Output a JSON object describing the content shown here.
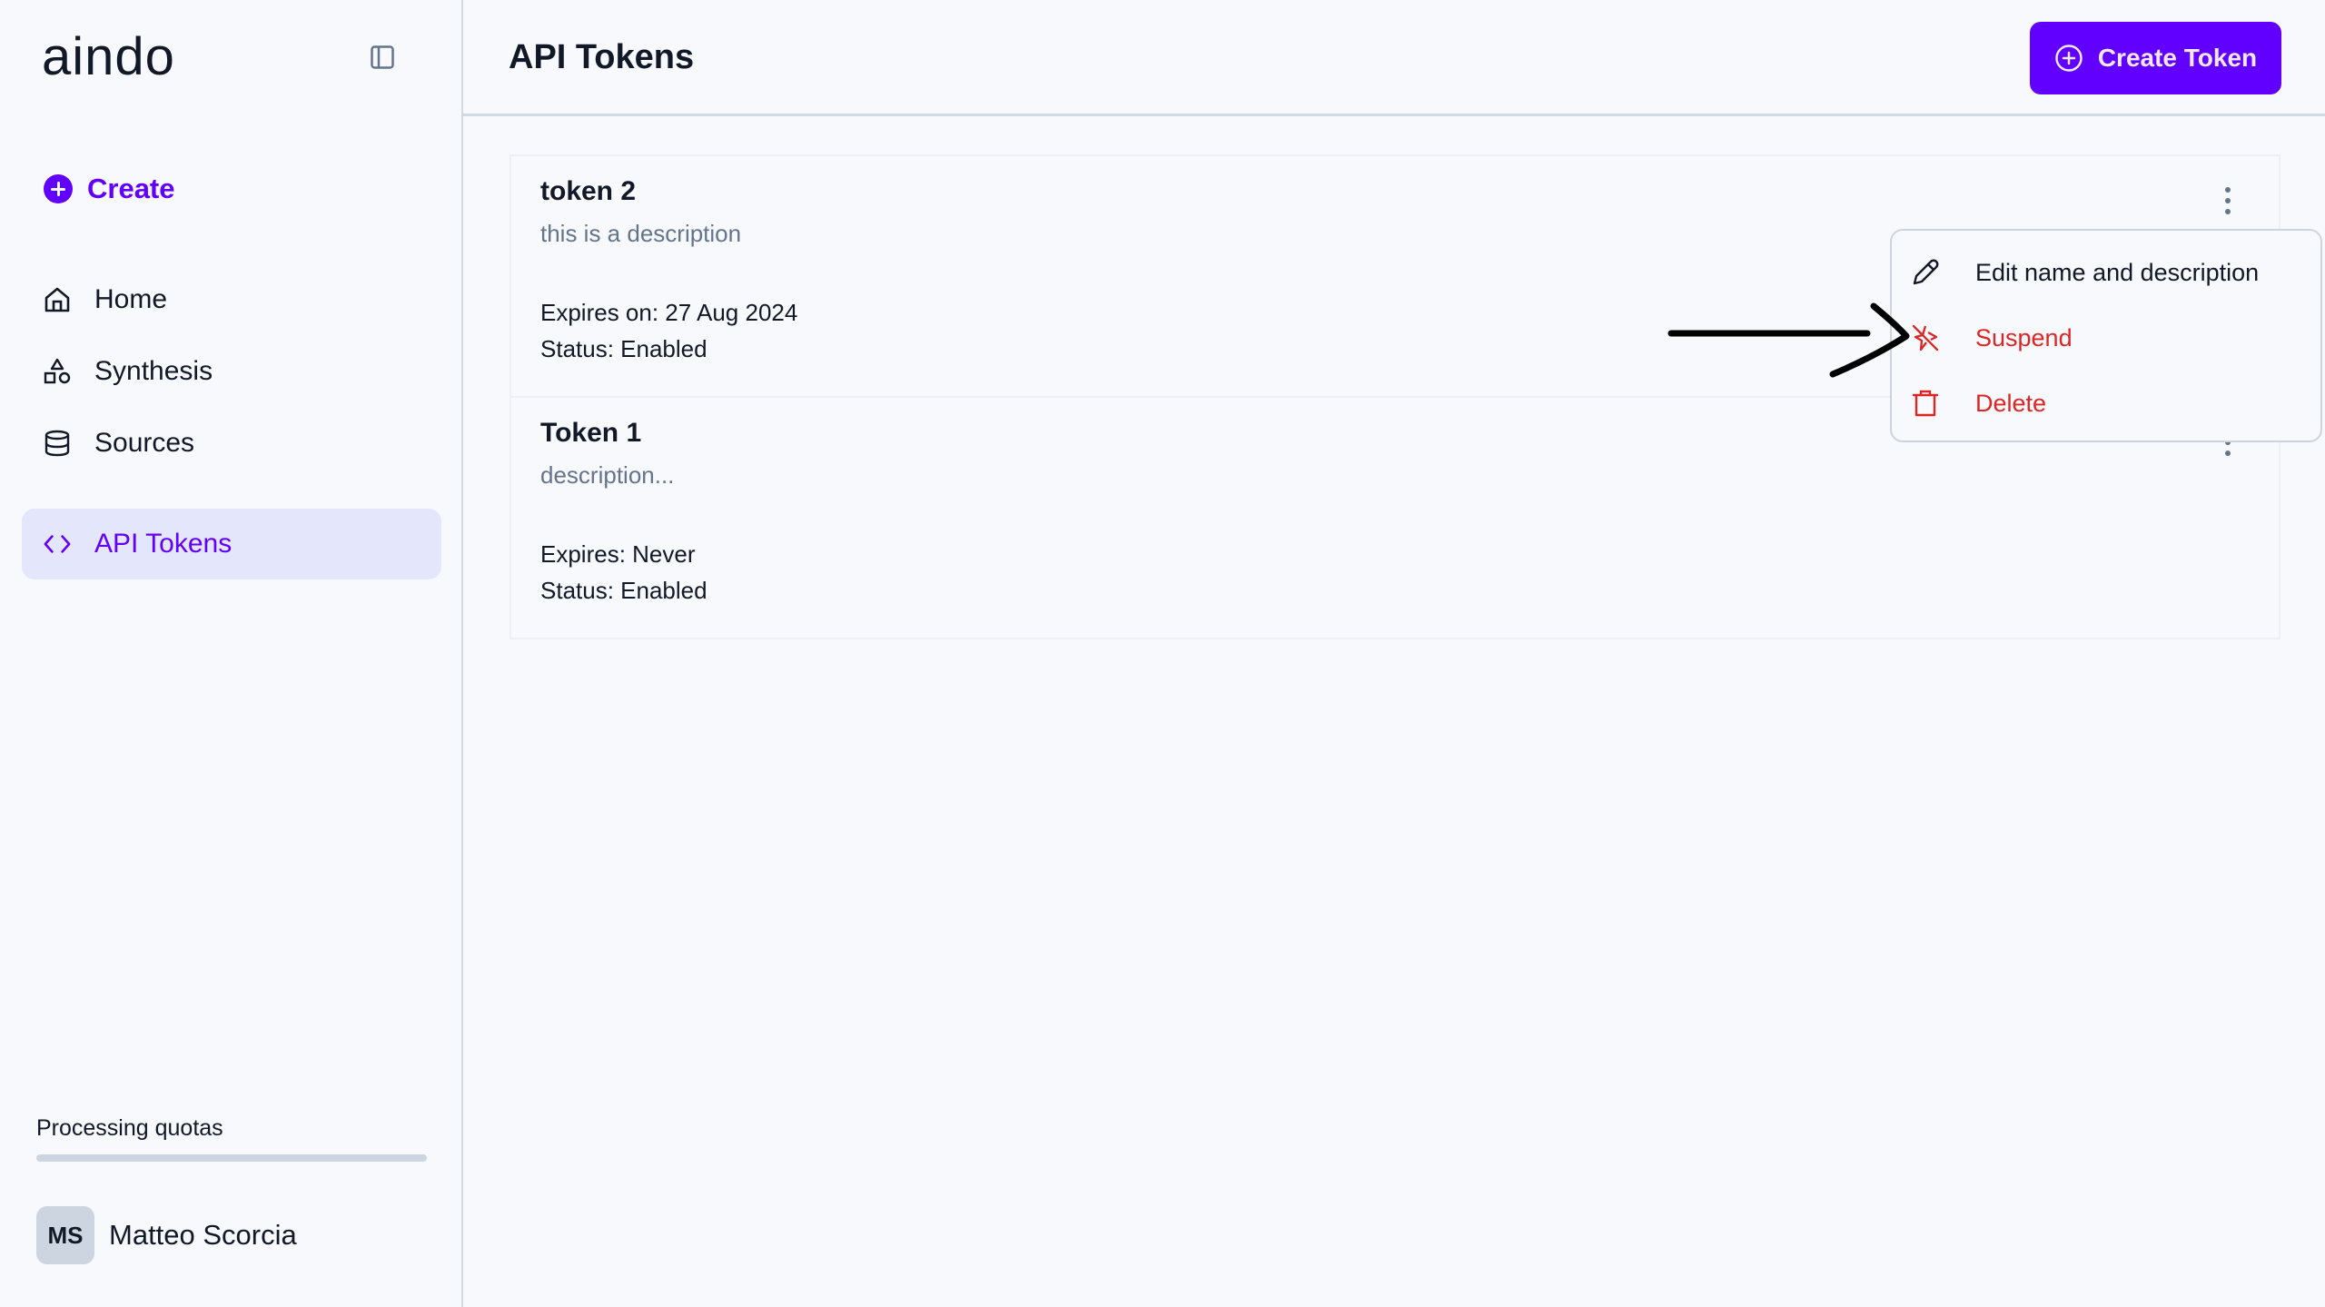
{
  "sidebar": {
    "logo": "aindo",
    "toggle_icon": "sidebar-panel-icon",
    "create_label": "Create",
    "nav": [
      {
        "label": "Home",
        "icon": "home-icon",
        "active": false
      },
      {
        "label": "Synthesis",
        "icon": "shapes-icon",
        "active": false
      },
      {
        "label": "Sources",
        "icon": "database-icon",
        "active": false
      },
      {
        "label": "API Tokens",
        "icon": "code-icon",
        "active": true
      }
    ],
    "quota": {
      "label": "Processing quotas",
      "progress_percent": 0
    },
    "user": {
      "initials": "MS",
      "name": "Matteo Scorcia"
    }
  },
  "header": {
    "title": "API Tokens",
    "create_token_label": "Create Token"
  },
  "tokens": [
    {
      "name": "token 2",
      "description": "this is a description",
      "expires": "Expires on: 27 Aug 2024",
      "status": "Status: Enabled"
    },
    {
      "name": "Token 1",
      "description": "description...",
      "expires": "Expires: Never",
      "status": "Status: Enabled"
    }
  ],
  "context_menu": {
    "items": [
      {
        "label": "Edit name and description",
        "icon": "pencil-icon",
        "variant": "normal"
      },
      {
        "label": "Suspend",
        "icon": "suspend-icon",
        "variant": "danger"
      },
      {
        "label": "Delete",
        "icon": "trash-icon",
        "variant": "danger"
      }
    ]
  },
  "colors": {
    "accent": "#6200ff",
    "danger": "#dc2626",
    "active_nav_bg": "#e4e6fb",
    "background": "#f7f9fc"
  }
}
